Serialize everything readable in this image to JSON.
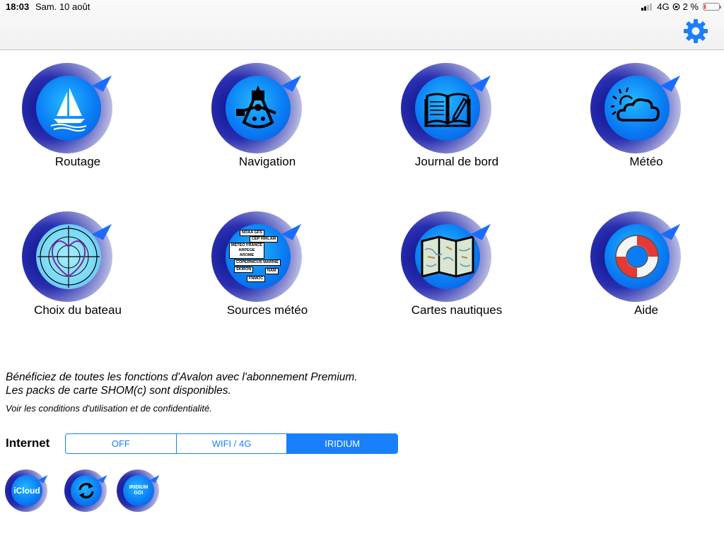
{
  "status_bar": {
    "time": "18:03",
    "date": "Sam. 10 août",
    "network": "4G",
    "battery": "2 %",
    "battery_level": 0.02
  },
  "nav": {
    "settings_icon": "gear-icon",
    "accent_color": "#1a7ffb"
  },
  "tiles": [
    {
      "label": "Routage",
      "icon": "sailboat-icon"
    },
    {
      "label": "Navigation",
      "icon": "sextant-icon"
    },
    {
      "label": "Journal de bord",
      "icon": "logbook-icon"
    },
    {
      "label": "Météo",
      "icon": "weather-icon"
    },
    {
      "label": "Choix du bateau",
      "icon": "polar-diagram-icon"
    },
    {
      "label": "Sources météo",
      "icon": "weather-sources-icon"
    },
    {
      "label": "Cartes nautiques",
      "icon": "nautical-map-icon"
    },
    {
      "label": "Aide",
      "icon": "lifebuoy-icon"
    }
  ],
  "weather_sources": [
    "NOAA GFS",
    "CEP HIRLAM",
    "METEO FRANCE",
    "ARPEGE",
    "AROME",
    "COPERNICUS MARINE",
    "SKIRON",
    "NAM",
    "FNMOC"
  ],
  "promo": {
    "line1": "Bénéficiez de toutes les fonctions d'Avalon avec l'abonnement Premium.",
    "line2": "Les packs de carte SHOM(c) sont disponibles.",
    "terms": "Voir les conditions d'utilisation et de confidentialité."
  },
  "internet": {
    "label": "Internet",
    "options": [
      "OFF",
      "WIFI / 4G",
      "IRIDIUM"
    ],
    "selected": "IRIDIUM"
  },
  "bottom_buttons": {
    "icloud": "iCloud",
    "sync_icon": "sync-icon",
    "iridium_line1": "IRIDIUM",
    "iridium_line2": "GO!"
  }
}
